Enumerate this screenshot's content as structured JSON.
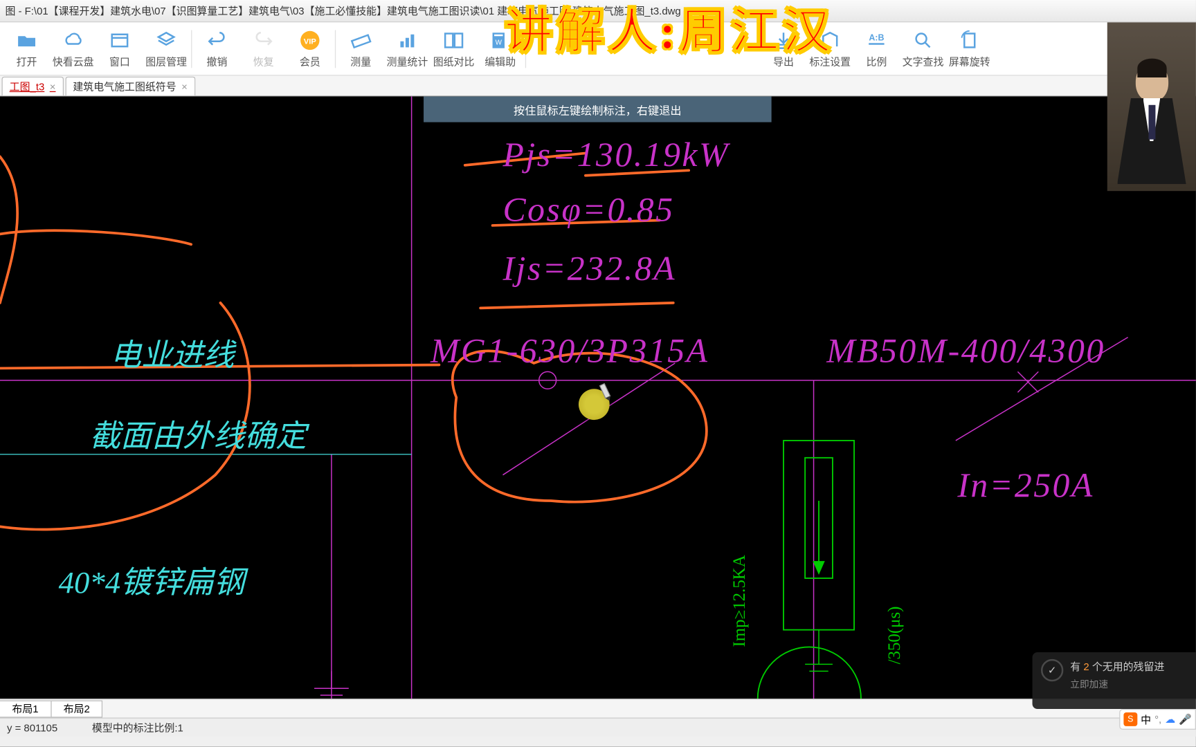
{
  "title_bar": "图 - F:\\01【课程开发】建筑水电\\07【识图算量工艺】建筑电气\\03【施工必懂技能】建筑电气施工图识读\\01 建筑电气施工图\\建筑电气施工图_t3.dwg",
  "toolbar": [
    {
      "label": "打开",
      "icon": "folder"
    },
    {
      "label": "快看云盘",
      "icon": "cloud"
    },
    {
      "label": "窗口",
      "icon": "window"
    },
    {
      "label": "图层管理",
      "icon": "layers"
    },
    {
      "label": "撤销",
      "icon": "undo"
    },
    {
      "label": "恢复",
      "icon": "redo",
      "dim": true
    },
    {
      "label": "会员",
      "icon": "vip"
    },
    {
      "label": "测量",
      "icon": "measure"
    },
    {
      "label": "测量统计",
      "icon": "stats"
    },
    {
      "label": "图纸对比",
      "icon": "compare"
    },
    {
      "label": "编辑助",
      "icon": "edit"
    },
    {
      "label": "",
      "icon": "blank1"
    },
    {
      "label": "",
      "icon": "blank2"
    },
    {
      "label": "",
      "icon": "blank3"
    },
    {
      "label": "",
      "icon": "blank4"
    },
    {
      "label": "",
      "icon": "blank5"
    },
    {
      "label": "导出",
      "icon": "export"
    },
    {
      "label": "标注设置",
      "icon": "anno"
    },
    {
      "label": "比例",
      "icon": "ratio"
    },
    {
      "label": "文字查找",
      "icon": "find"
    },
    {
      "label": "屏幕旋转",
      "icon": "rotate"
    }
  ],
  "tabs": [
    {
      "label": "工图_t3",
      "active": true
    },
    {
      "label": "建筑电气施工图纸符号",
      "active": false
    }
  ],
  "hint": "按住鼠标左键绘制标注，右键退出",
  "overlay": "讲解人:周江汉",
  "cad": {
    "pjs": "Pjs=130.19kW",
    "cos": "Cosφ=0.85",
    "ijs": "Ijs=232.8A",
    "mg1": "MG1-630/3P315A",
    "mb50": "MB50M-400/4300",
    "in250": "In=250A",
    "dianye": "电业进线",
    "jiemian": "截面由外线确定",
    "biangang": "40*4镀锌扁钢",
    "imp": "Imp≥12.5KA",
    "s350": "/350(μs)"
  },
  "layout_tabs": [
    "布局1",
    "布局2"
  ],
  "status": {
    "coord": "y = 801105",
    "scale": "模型中的标注比例:1"
  },
  "notif": {
    "count": "2",
    "text": "有 2 个无用的残留进",
    "sub": "立即加速"
  },
  "ime": "中"
}
